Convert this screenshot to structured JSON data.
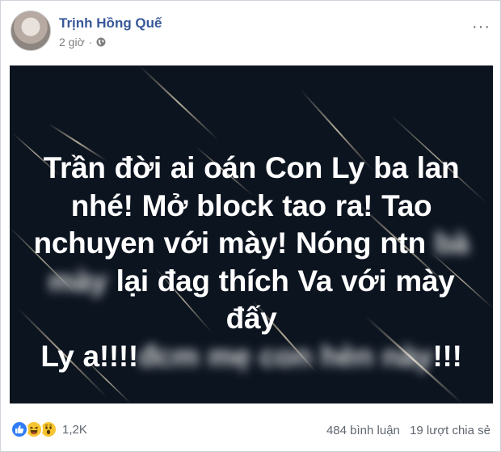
{
  "post": {
    "author": "Trịnh Hồng Quế",
    "time": "2 giờ",
    "separator": "·",
    "privacy_icon": "globe-icon",
    "more_label": "···"
  },
  "image_text": {
    "line1": "Trần đời ai oán Con Ly ba lan",
    "line2": "nhé! Mở block tao ra! Tao",
    "line3_visible": "nchuyen với mày! Nóng ntn",
    "line3_blurred": "bà",
    "line4_blurred": "mày",
    "line4_visible": "lại đag thích Va với mày đấy",
    "line5_start": "Ly a!!!!",
    "line5_blurred": "đcm mẹ con hèn này",
    "line5_end": "!!!"
  },
  "footer": {
    "reactions": [
      "like-icon",
      "haha-icon",
      "wow-icon"
    ],
    "reaction_count": "1,2K",
    "comments": "484 bình luận",
    "shares": "19 lượt chia sẻ"
  },
  "colors": {
    "author_link": "#385898",
    "image_bg": "#0c1420",
    "like_blue": "#2f7cf6",
    "emoji_yellow": "#f7c531"
  }
}
